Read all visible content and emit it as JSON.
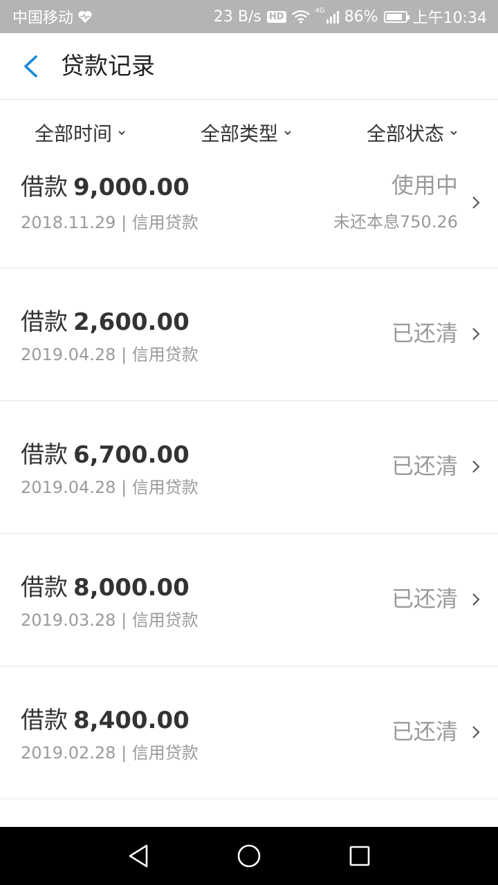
{
  "status_bar": {
    "carrier": "中国移动",
    "net_speed": "23 B/s",
    "hd": "HD",
    "network": "4G",
    "battery": "86%",
    "battery_level": 0.86,
    "time": "上午10:34"
  },
  "header": {
    "title": "贷款记录"
  },
  "filters": {
    "time": "全部时间",
    "type": "全部类型",
    "status": "全部状态"
  },
  "loans": [
    {
      "prefix": "借款",
      "amount": "9,000.00",
      "date": "2018.11.29",
      "separator": "|",
      "category": "信用贷款",
      "status": "使用中",
      "remaining": "未还本息750.26"
    },
    {
      "prefix": "借款",
      "amount": "2,600.00",
      "date": "2019.04.28",
      "separator": "|",
      "category": "信用贷款",
      "status": "已还清"
    },
    {
      "prefix": "借款",
      "amount": "6,700.00",
      "date": "2019.04.28",
      "separator": "|",
      "category": "信用贷款",
      "status": "已还清"
    },
    {
      "prefix": "借款",
      "amount": "8,000.00",
      "date": "2019.03.28",
      "separator": "|",
      "category": "信用贷款",
      "status": "已还清"
    },
    {
      "prefix": "借款",
      "amount": "8,400.00",
      "date": "2019.02.28",
      "separator": "|",
      "category": "信用贷款",
      "status": "已还清"
    }
  ],
  "colors": {
    "accent": "#1a8ad8",
    "status_bar_bg": "#b4b4b4",
    "muted_text": "#9a9a9a"
  }
}
